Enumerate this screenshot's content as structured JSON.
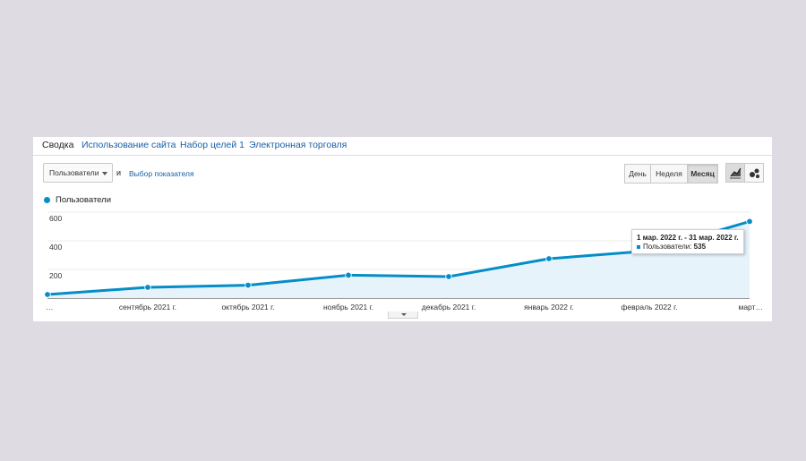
{
  "tabs": [
    {
      "label": "Сводка",
      "active": true
    },
    {
      "label": "Использование сайта",
      "active": false
    },
    {
      "label": "Набор целей 1",
      "active": false
    },
    {
      "label": "Электронная торговля",
      "active": false
    }
  ],
  "controls": {
    "metric_select": "Пользователи",
    "and_text": "и",
    "pick_metric_link": "Выбор показателя",
    "granularity": [
      {
        "label": "День",
        "active": false
      },
      {
        "label": "Неделя",
        "active": false
      },
      {
        "label": "Месяц",
        "active": true
      }
    ],
    "view_buttons": [
      {
        "icon": "line-chart-icon",
        "active": true
      },
      {
        "icon": "motion-chart-icon",
        "active": false
      }
    ]
  },
  "legend": {
    "label": "Пользователи",
    "color": "#058dc7"
  },
  "tooltip": {
    "range": "1 мар. 2022 г. - 31 мар. 2022 г.",
    "metric_label": "Пользователи:",
    "metric_value": "535"
  },
  "chart_data": {
    "type": "area",
    "x": [
      "…",
      "сентябрь 2021 г.",
      "октябрь 2021 г.",
      "ноябрь 2021 г.",
      "декабрь 2021 г.",
      "январь 2022 г.",
      "февраль 2022 г.",
      "март…"
    ],
    "series": [
      {
        "name": "Пользователи",
        "values": [
          25,
          75,
          90,
          160,
          150,
          275,
          330,
          535
        ]
      }
    ],
    "ylim": [
      0,
      600
    ],
    "yticks": [
      200,
      400,
      600
    ],
    "grid": true,
    "color": "#058dc7",
    "fill": "#e6f3fb"
  }
}
